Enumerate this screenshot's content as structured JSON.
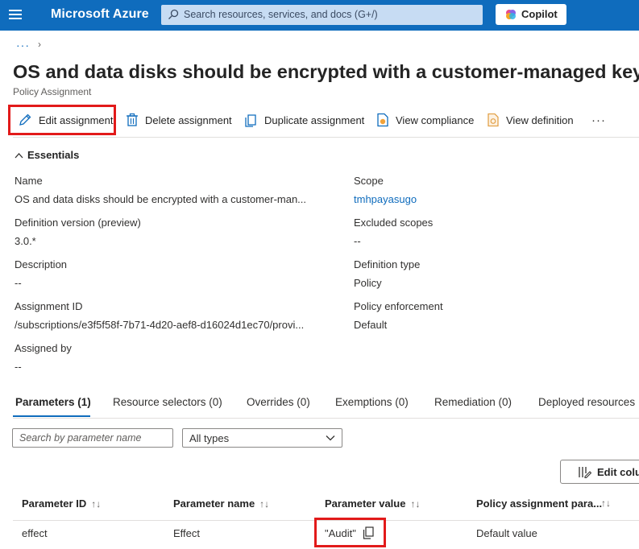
{
  "app": {
    "brand": "Microsoft Azure",
    "search_placeholder": "Search resources, services, and docs (G+/)",
    "copilot_label": "Copilot",
    "accent_color": "#0f6cbd"
  },
  "breadcrumb": {
    "ellipsis": "···",
    "chevron": "›"
  },
  "page": {
    "title": "OS and data disks should be encrypted with a customer-managed key",
    "subtitle": "Policy Assignment"
  },
  "toolbar": {
    "edit": "Edit assignment",
    "delete": "Delete assignment",
    "duplicate": "Duplicate assignment",
    "compliance": "View compliance",
    "definition": "View definition",
    "more": "···"
  },
  "essentials": {
    "heading": "Essentials",
    "left": [
      {
        "label": "Name",
        "value": "OS and data disks should be encrypted with a customer-man..."
      },
      {
        "label": "Definition version (preview)",
        "value": "3.0.*"
      },
      {
        "label": "Description",
        "value": "--"
      },
      {
        "label": "Assignment ID",
        "value": "/subscriptions/e3f5f58f-7b71-4d20-aef8-d16024d1ec70/provi..."
      },
      {
        "label": "Assigned by",
        "value": "--"
      }
    ],
    "right": [
      {
        "label": "Scope",
        "value": "tmhpayasugo"
      },
      {
        "label": "Excluded scopes",
        "value": "--"
      },
      {
        "label": "Definition type",
        "value": "Policy"
      },
      {
        "label": "Policy enforcement",
        "value": "Default"
      }
    ]
  },
  "tabs": [
    {
      "label": "Parameters (1)",
      "active": true
    },
    {
      "label": "Resource selectors (0)",
      "active": false
    },
    {
      "label": "Overrides (0)",
      "active": false
    },
    {
      "label": "Exemptions (0)",
      "active": false
    },
    {
      "label": "Remediation (0)",
      "active": false
    },
    {
      "label": "Deployed resources",
      "active": false
    }
  ],
  "filters": {
    "search_placeholder": "Search by parameter name",
    "type_selected": "All types"
  },
  "edit_columns_label": "Edit colu",
  "table": {
    "sort_glyph": "↑↓",
    "headers": [
      "Parameter ID",
      "Parameter name",
      "Parameter value",
      "Policy assignment para..."
    ],
    "rows": [
      {
        "id": "effect",
        "name": "Effect",
        "value": "\"Audit\"",
        "source": "Default value"
      }
    ]
  },
  "highlight_color": "#e21a1a"
}
